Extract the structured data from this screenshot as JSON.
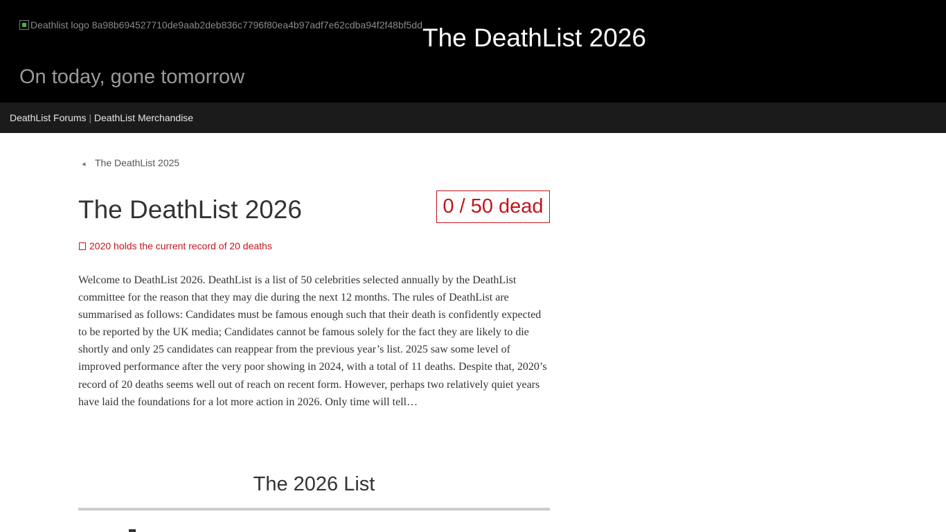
{
  "header": {
    "logo_alt": "Deathlist logo 8a98b694527710de9aab2deb836c7796f80ea4b97adf7e62cdba94f2f48bf5dd",
    "site_title": "The DeathList 2026",
    "tagline": "On today, gone tomorrow"
  },
  "nav": {
    "forums_label": "DeathList Forums",
    "separator": "|",
    "merch_label": "DeathList Merchandise"
  },
  "main": {
    "prev_link_icon": "left-arrow-icon",
    "prev_link_label": "The DeathList 2025",
    "page_title": "The DeathList 2026",
    "dead_counter": "0 / 50 dead",
    "record_icon": "trophy-icon",
    "record_note": "2020 holds the current record of 20 deaths",
    "intro": "Welcome to DeathList 2026. DeathList is a list of 50 celebrities selected annually by the DeathList committee for the reason that they may die during the next 12 months. The rules of DeathList are summarised as follows: Candidates must be famous enough such that their death is confidently expected to be reported by the UK media; Candidates cannot be famous solely for the fact they are likely to die shortly and only 25 candidates can reappear from the previous year’s list. 2025 saw some level of improved performance after the very poor showing in 2024, with a total of 11 deaths. Despite that, 2020’s record of 20 deaths seems well out of reach on recent form. However, perhaps two relatively quiet years have laid the foundations for a lot more action in 2026. Only time will tell…",
    "list_heading": "The 2026 List"
  },
  "colors": {
    "header_bg": "#000000",
    "nav_bg": "#1b1b1b",
    "accent_red": "#c0151b",
    "text": "#333333"
  }
}
